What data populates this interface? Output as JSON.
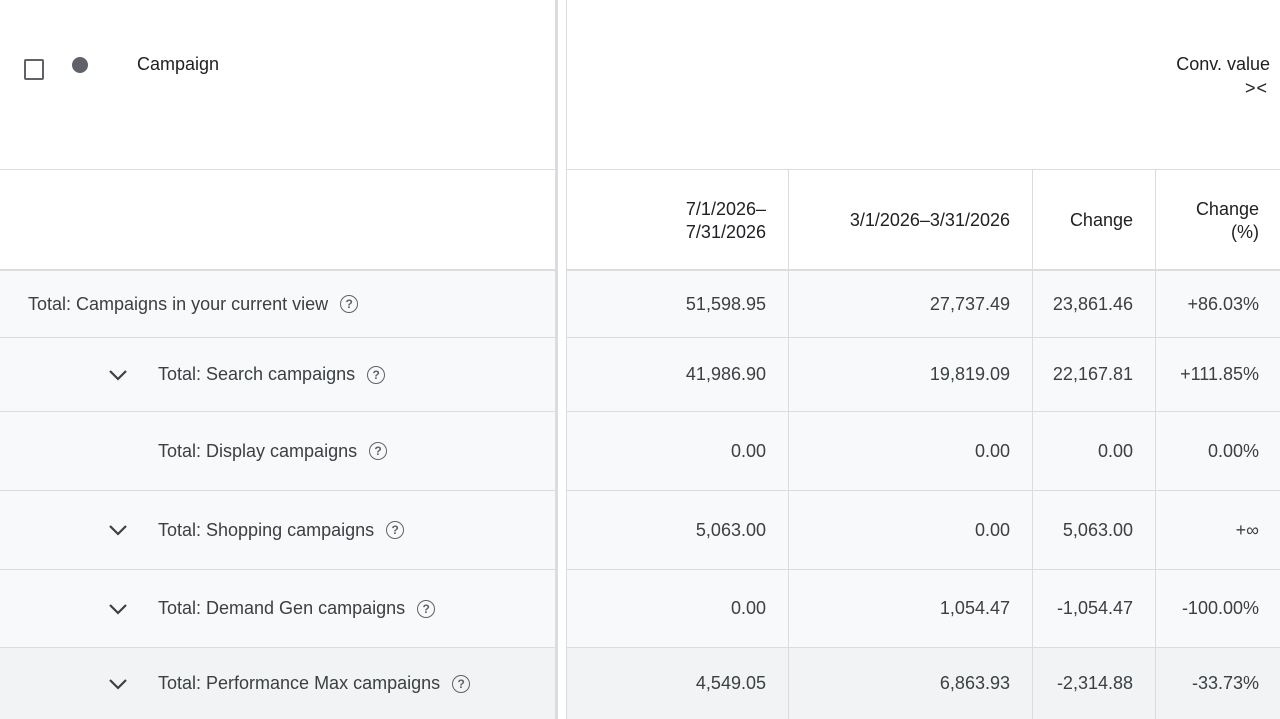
{
  "header": {
    "campaign_label": "Campaign",
    "metric_label": "Conv. value",
    "collapse_glyph": "><"
  },
  "subheader": {
    "period1": "7/1/2026–\n7/31/2026",
    "period2": "3/1/2026–3/31/2026",
    "change": "Change",
    "change_pct": "Change\n(%)"
  },
  "rows": [
    {
      "label": "Total: Campaigns in your current view",
      "v1": "51,598.95",
      "v2": "27,737.49",
      "change": "23,861.46",
      "pct": "+86.03%"
    },
    {
      "label": "Total: Search campaigns",
      "v1": "41,986.90",
      "v2": "19,819.09",
      "change": "22,167.81",
      "pct": "+111.85%"
    },
    {
      "label": "Total: Display campaigns",
      "v1": "0.00",
      "v2": "0.00",
      "change": "0.00",
      "pct": "0.00%"
    },
    {
      "label": "Total: Shopping campaigns",
      "v1": "5,063.00",
      "v2": "0.00",
      "change": "5,063.00",
      "pct": "+∞"
    },
    {
      "label": "Total: Demand Gen campaigns",
      "v1": "0.00",
      "v2": "1,054.47",
      "change": "-1,054.47",
      "pct": "-100.00%"
    },
    {
      "label": "Total: Performance Max campaigns",
      "v1": "4,549.05",
      "v2": "6,863.93",
      "change": "-2,314.88",
      "pct": "-33.73%"
    }
  ],
  "icons": {
    "help": "help-circle-icon",
    "chevron": "chevron-down-icon",
    "collapse": "collapse-columns-icon"
  }
}
